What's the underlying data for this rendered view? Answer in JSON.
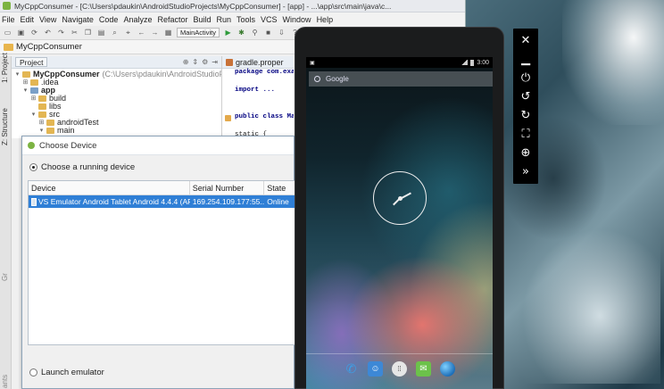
{
  "window": {
    "title": "MyCppConsumer - [C:\\Users\\pdaukin\\AndroidStudioProjects\\MyCppConsumer] - [app] - ...\\app\\src\\main\\java\\c..."
  },
  "menu": [
    "File",
    "Edit",
    "View",
    "Navigate",
    "Code",
    "Analyze",
    "Refactor",
    "Build",
    "Run",
    "Tools",
    "VCS",
    "Window",
    "Help"
  ],
  "toolbar": {
    "run_config": "MainActivity"
  },
  "breadcrumb": "MyCppConsumer",
  "side_tabs": {
    "project": "1: Project",
    "structure": "Z: Structure",
    "grad": "Gr",
    "ants": "ants"
  },
  "project_panel": {
    "tab": "Project",
    "tree": [
      {
        "label": "MyCppConsumer",
        "path": "(C:\\Users\\pdaukin\\AndroidStudioPr",
        "indent": 0,
        "twisty": "▾"
      },
      {
        "label": ".idea",
        "indent": 1,
        "twisty": "⊞"
      },
      {
        "label": "app",
        "indent": 1,
        "twisty": "▾"
      },
      {
        "label": "build",
        "indent": 2,
        "twisty": "⊞"
      },
      {
        "label": "libs",
        "indent": 2,
        "twisty": ""
      },
      {
        "label": "src",
        "indent": 2,
        "twisty": "▾"
      },
      {
        "label": "androidTest",
        "indent": 3,
        "twisty": "⊞"
      },
      {
        "label": "main",
        "indent": 3,
        "twisty": "▾"
      }
    ]
  },
  "editor": {
    "tab": "gradle.proper",
    "lines": [
      "package com.examp",
      "",
      "import ...",
      "",
      "",
      "public class Main",
      "",
      "    static {"
    ]
  },
  "dialog": {
    "title": "Choose Device",
    "running_option": "Choose a running device",
    "launch_option": "Launch emulator",
    "columns": [
      "Device",
      "Serial Number",
      "State"
    ],
    "rows": [
      {
        "device": "VS Emulator Android Tablet Android 4.4.4 (AP",
        "serial": "169.254.109.177:55...",
        "state": "Online"
      }
    ]
  },
  "phone": {
    "time": "3:00",
    "search_label": "Google"
  },
  "emulator_tools": [
    {
      "name": "close-icon",
      "glyph": "✕"
    },
    {
      "name": "minimize-icon",
      "glyph": "▁"
    },
    {
      "name": "power-icon",
      "glyph": "⏻"
    },
    {
      "name": "rotate-left-icon",
      "glyph": "↺"
    },
    {
      "name": "rotate-right-icon",
      "glyph": "↻"
    },
    {
      "name": "fit-screen-icon",
      "glyph": "⛶"
    },
    {
      "name": "zoom-icon",
      "glyph": "⊕"
    },
    {
      "name": "more-tools-icon",
      "glyph": "»"
    }
  ]
}
